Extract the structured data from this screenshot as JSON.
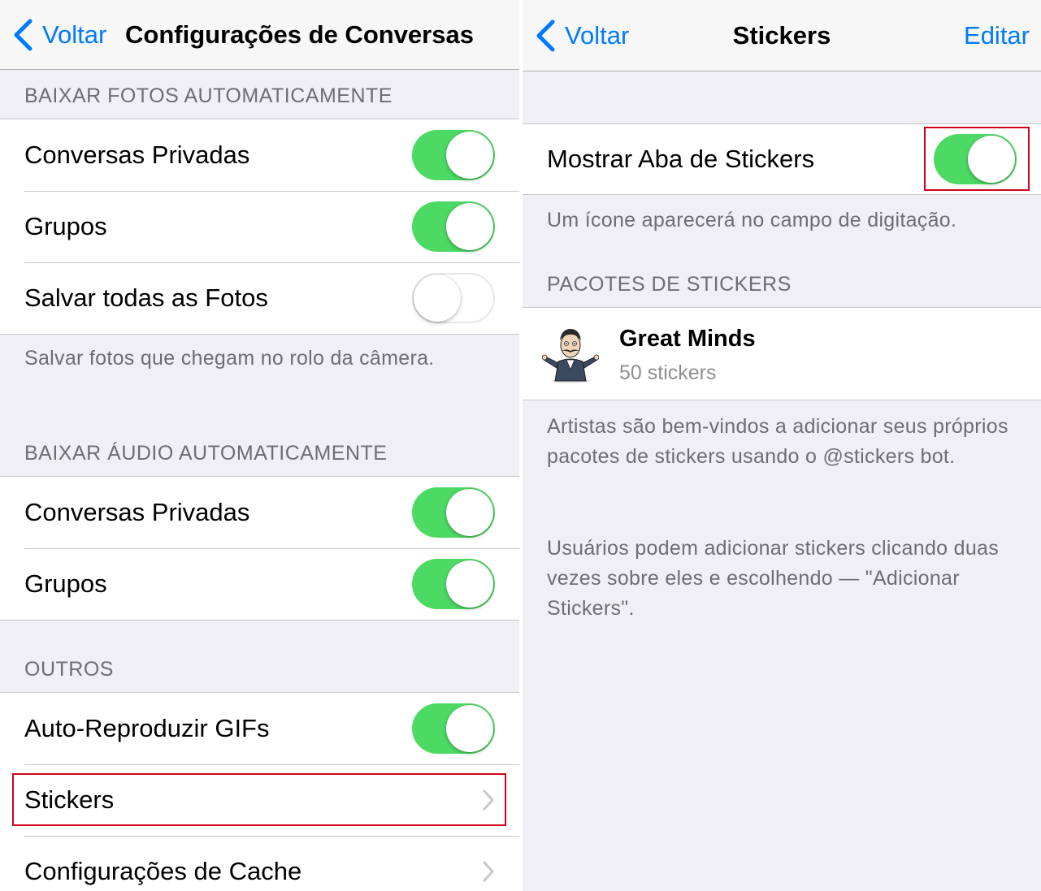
{
  "left": {
    "nav": {
      "back_label": "Voltar",
      "title": "Configurações de Conversas"
    },
    "photos": {
      "header": "BAIXAR FOTOS AUTOMATICAMENTE",
      "rows": [
        {
          "label": "Conversas Privadas",
          "on": true
        },
        {
          "label": "Grupos",
          "on": true
        },
        {
          "label": "Salvar todas as Fotos",
          "on": false
        }
      ],
      "footer": "Salvar fotos que chegam no rolo da câmera."
    },
    "audio": {
      "header": "BAIXAR ÁUDIO AUTOMATICAMENTE",
      "rows": [
        {
          "label": "Conversas Privadas",
          "on": true
        },
        {
          "label": "Grupos",
          "on": true
        }
      ]
    },
    "others": {
      "header": "OUTROS",
      "rows": [
        {
          "label": "Auto-Reproduzir GIFs",
          "on": true
        },
        {
          "label": "Stickers"
        },
        {
          "label": "Configurações de Cache"
        }
      ]
    }
  },
  "right": {
    "nav": {
      "back_label": "Voltar",
      "title": "Stickers",
      "edit_label": "Editar"
    },
    "show_tab": {
      "label": "Mostrar Aba de Stickers",
      "on": true
    },
    "show_tab_footer": "Um ícone aparecerá no campo de digitação.",
    "packs_header": "PACOTES DE STICKERS",
    "packs": [
      {
        "name": "Great Minds",
        "count": "50 stickers"
      }
    ],
    "footer_1": "Artistas são bem-vindos a adicionar seus próprios pacotes de stickers usando o @stickers bot.",
    "footer_2": "Usuários podem adicionar stickers clicando duas vezes sobre eles e escolhendo — \"Adicionar Stickers\"."
  },
  "colors": {
    "accent": "#007aff",
    "toggle_on": "#4cd964",
    "highlight": "#d0021b",
    "background": "#efeff4"
  }
}
